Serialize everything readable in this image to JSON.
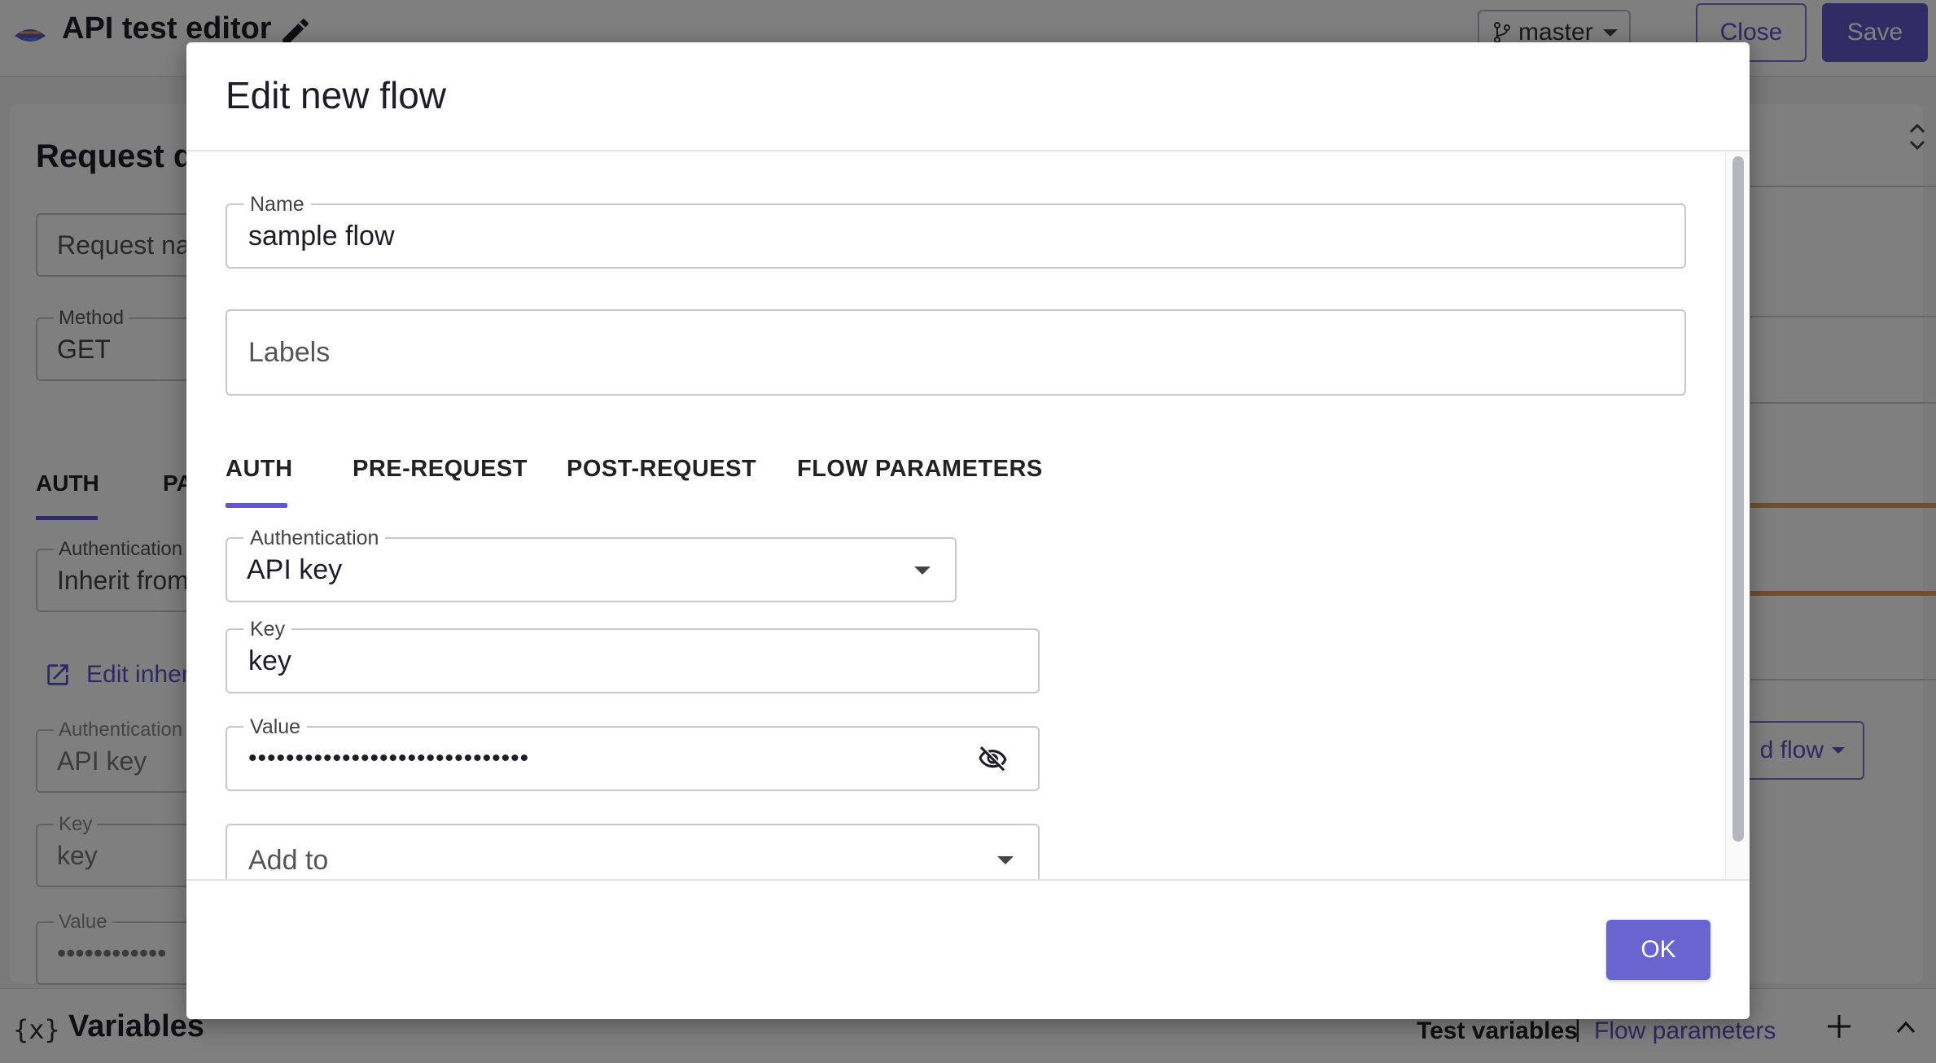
{
  "app": {
    "title": "API test editor",
    "branch": "master",
    "close_label": "Close",
    "save_label": "Save"
  },
  "background": {
    "heading": "Request de",
    "request_name_placeholder": "Request na",
    "method_label": "Method",
    "method_value": "GET",
    "tabs": [
      "AUTH",
      "PA"
    ],
    "auth_label": "Authentication",
    "auth_value": "Inherit from",
    "edit_inherited_link": "Edit inher",
    "auth2_label": "Authentication",
    "auth2_value": "API key",
    "key_label": "Key",
    "key_value": "key",
    "value_label": "Value",
    "value_masked": "••••••••••••",
    "add_flow_label": "d flow"
  },
  "bottom_bar": {
    "icon_text": "{x}",
    "title": "Variables",
    "test_variables": "Test variables",
    "separator": "|",
    "flow_parameters": "Flow parameters"
  },
  "modal": {
    "title": "Edit new flow",
    "name_label": "Name",
    "name_value": "sample flow",
    "labels_placeholder": "Labels",
    "tabs": [
      "AUTH",
      "PRE-REQUEST",
      "POST-REQUEST",
      "FLOW PARAMETERS"
    ],
    "active_tab": "AUTH",
    "authentication_label": "Authentication",
    "authentication_value": "API key",
    "key_label": "Key",
    "key_value": "key",
    "value_label": "Value",
    "value_masked": "••••••••••••••••••••••••••••••",
    "add_to_placeholder": "Add to",
    "ok_label": "OK"
  },
  "colors": {
    "accent": "#5f59c8",
    "ok_button": "#6a64cf",
    "overlay": "rgba(0,0,0,0.5)"
  }
}
